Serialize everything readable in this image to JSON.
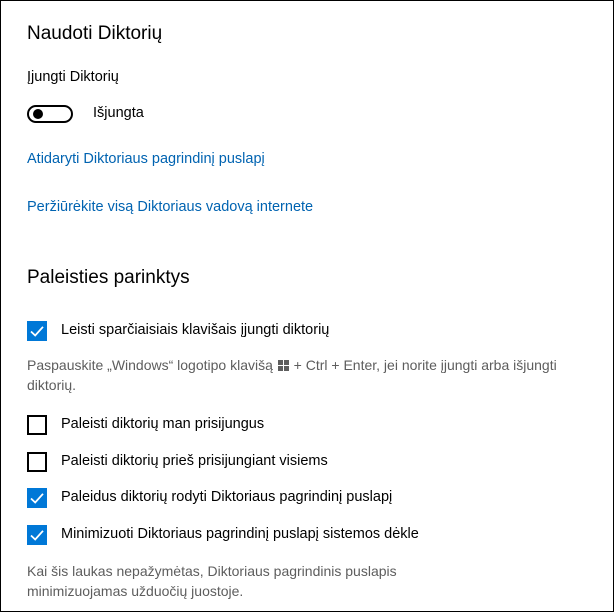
{
  "use_narrator": {
    "title": "Naudoti Diktorių",
    "toggle_label": "Įjungti Diktorių",
    "toggle_state_text": "Išjungta",
    "toggle_on": false,
    "link_home": "Atidaryti Diktoriaus pagrindinį puslapį",
    "link_guide": "Peržiūrėkite visą Diktoriaus vadovą internete"
  },
  "startup_options": {
    "title": "Paleisties parinktys",
    "shortcut": {
      "label": "Leisti sparčiaisiais klavišais įjungti diktorių",
      "checked": true,
      "hint_before": "Paspauskite „Windows“ logotipo klavišą",
      "hint_after": "+ Ctrl + Enter, jei norite įjungti arba išjungti diktorių.",
      "hint_icon": "windows-logo-icon"
    },
    "after_signin": {
      "label": "Paleisti diktorių man prisijungus",
      "checked": false
    },
    "before_signin": {
      "label": "Paleisti diktorių prieš prisijungiant visiems",
      "checked": false
    },
    "show_home": {
      "label": "Paleidus diktorių rodyti Diktoriaus pagrindinį puslapį",
      "checked": true
    },
    "minimize_tray": {
      "label": "Minimizuoti Diktoriaus pagrindinį puslapį sistemos dėkle",
      "checked": true,
      "hint": "Kai šis laukas nepažymėtas, Diktoriaus pagrindinis puslapis minimizuojamas užduočių juostoje."
    }
  },
  "colors": {
    "accent": "#0078d7",
    "link": "#0063b1",
    "hint_text": "#5d5d5d"
  }
}
